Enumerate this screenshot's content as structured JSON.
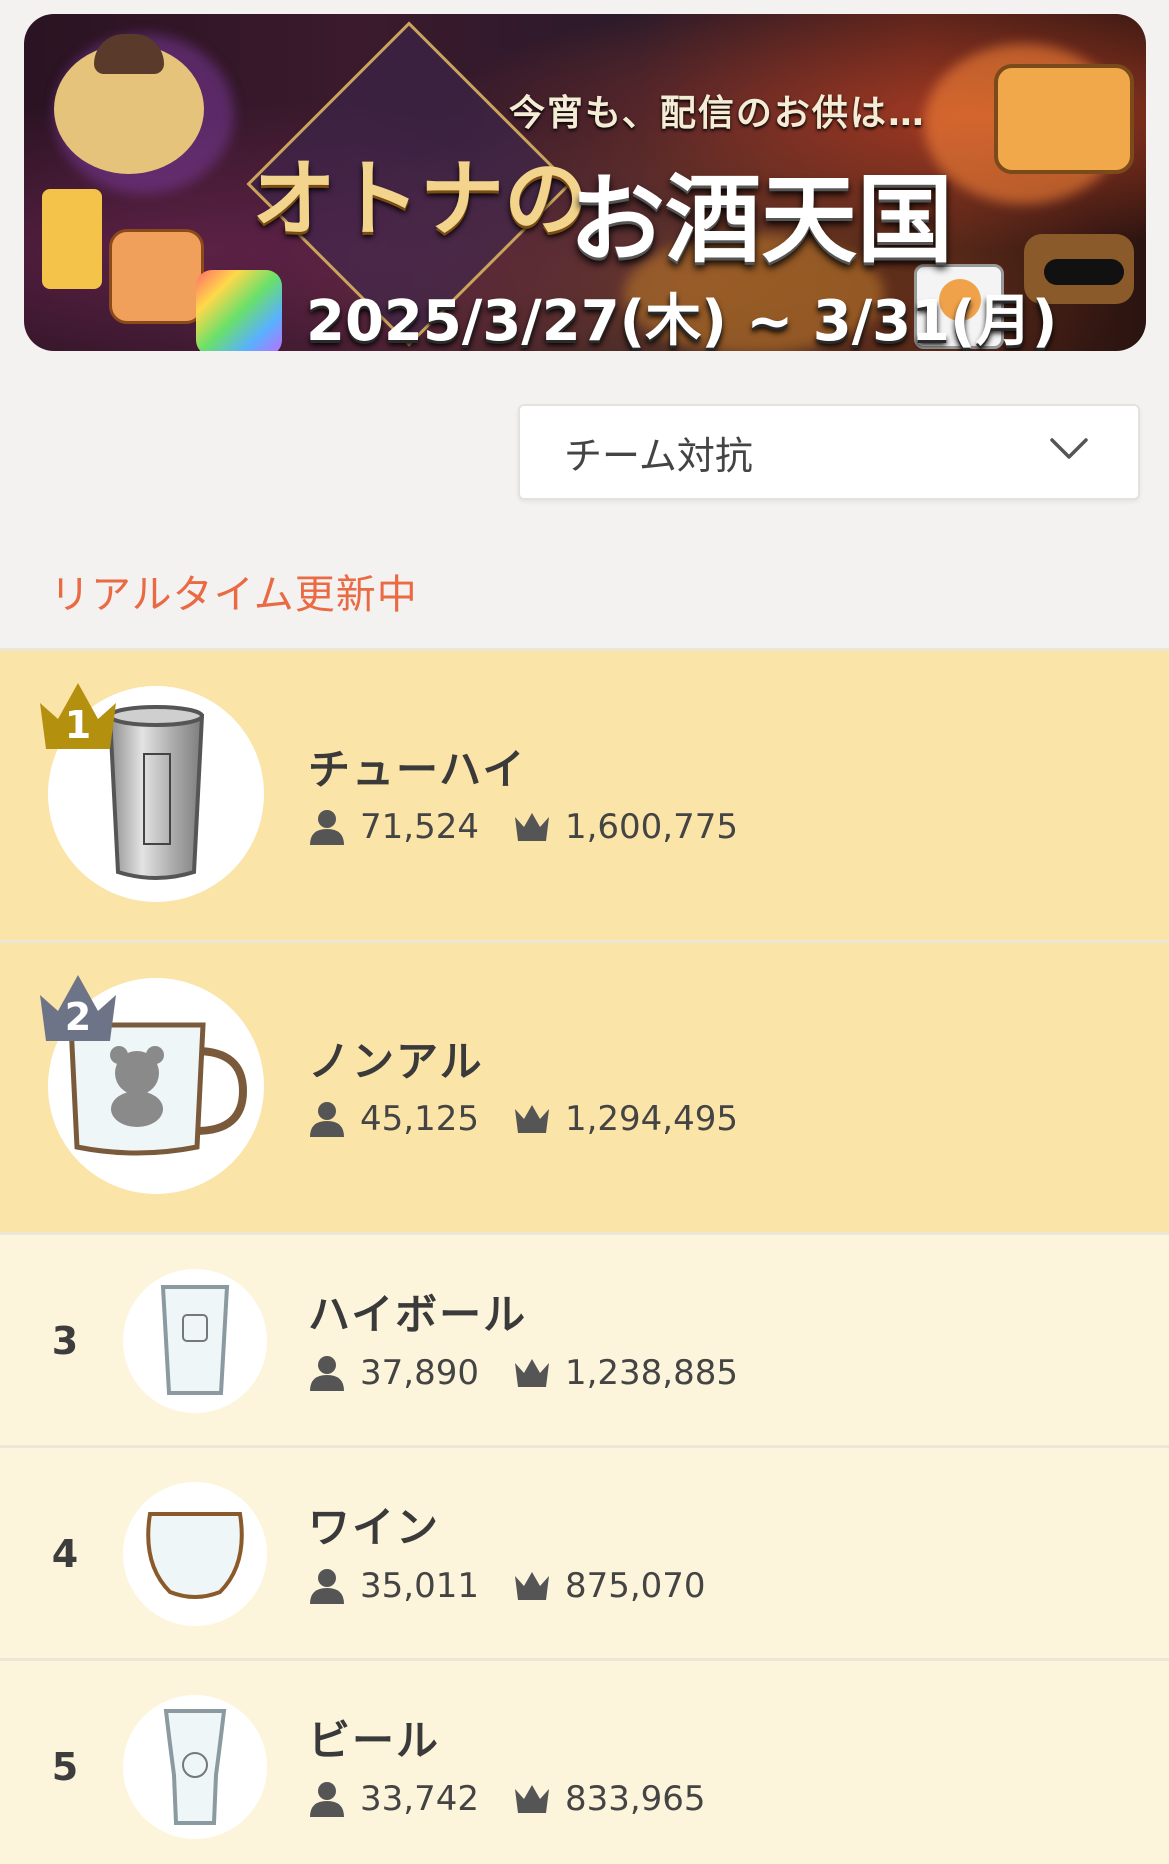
{
  "banner": {
    "subtitle": "今宵も、配信のお供は…",
    "title_part1": "オトナの",
    "title_part2": "お酒天国",
    "dates": "2025/3/27(木) ~ 3/31(月)"
  },
  "filter": {
    "selected": "チーム対抗"
  },
  "status_label": "リアルタイム更新中",
  "colors": {
    "gold_row": "#fbe4a8",
    "light_row": "#fdf5db",
    "accent": "#ea6a44",
    "gold_crown": "#b4900f",
    "silver_crown": "#6e7487"
  },
  "ranking": [
    {
      "rank": "1",
      "name": "チューハイ",
      "members": "71,524",
      "score": "1,600,775",
      "icon": "tumbler-icon"
    },
    {
      "rank": "2",
      "name": "ノンアル",
      "members": "45,125",
      "score": "1,294,495",
      "icon": "bear-mug-icon"
    },
    {
      "rank": "3",
      "name": "ハイボール",
      "members": "37,890",
      "score": "1,238,885",
      "icon": "highball-glass-icon"
    },
    {
      "rank": "4",
      "name": "ワイン",
      "members": "35,011",
      "score": "875,070",
      "icon": "wine-glass-icon"
    },
    {
      "rank": "5",
      "name": "ビール",
      "members": "33,742",
      "score": "833,965",
      "icon": "beer-glass-icon"
    }
  ]
}
